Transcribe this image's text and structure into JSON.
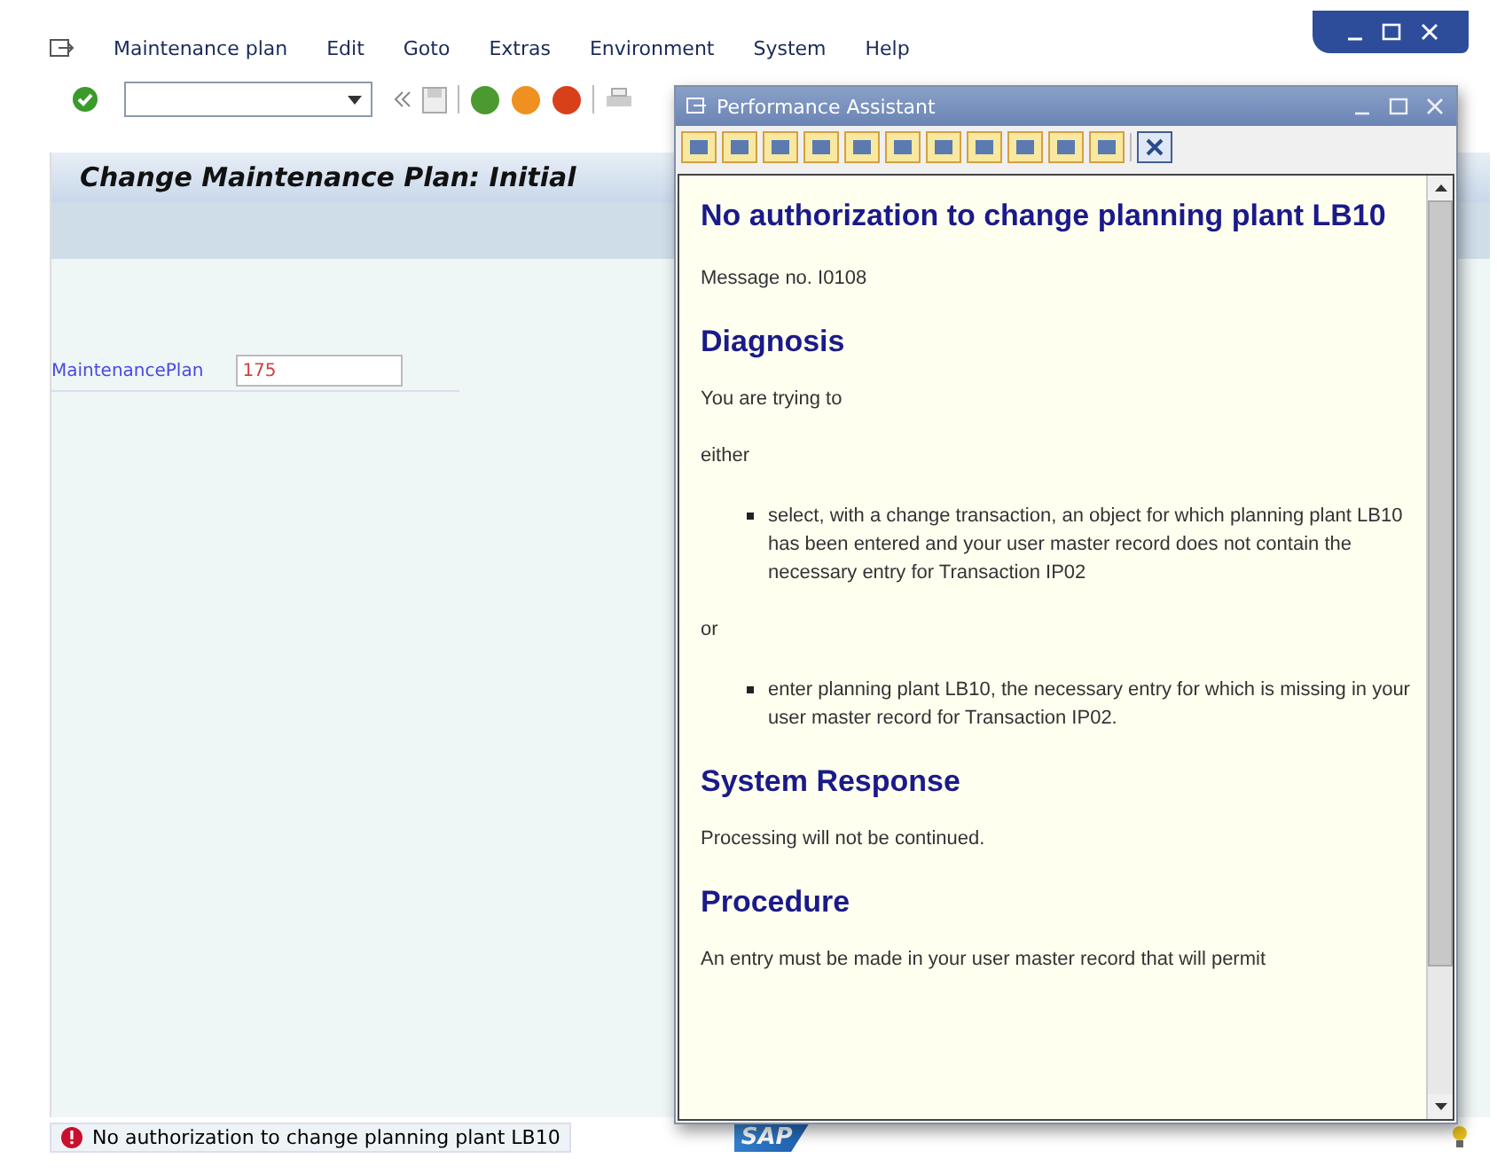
{
  "menu_bar": {
    "items": [
      "Maintenance plan",
      "Edit",
      "Goto",
      "Extras",
      "Environment",
      "System",
      "Help"
    ]
  },
  "screen_title": "Change Maintenance Plan: Initial",
  "field": {
    "label": "MaintenancePlan",
    "value": "175"
  },
  "status_bar": {
    "message": "No authorization to change planning plant LB10",
    "logo": "SAP"
  },
  "popup": {
    "title": "Performance Assistant",
    "content": [
      {
        "kind": "title",
        "text": "No authorization to change planning plant LB10"
      },
      {
        "kind": "text",
        "text": "Message no. I0108"
      },
      {
        "kind": "heading",
        "text": "Diagnosis"
      },
      {
        "kind": "text",
        "text": "You are trying to"
      },
      {
        "kind": "text",
        "text": "either"
      },
      {
        "kind": "bullet",
        "text": "select, with a change transaction, an object for which planning plant LB10 has been entered and your user master record does not contain the necessary entry for Transaction IP02"
      },
      {
        "kind": "text",
        "text": "or"
      },
      {
        "kind": "bullet",
        "text": "enter planning plant LB10, the necessary entry for which is missing in your user master record for Transaction IP02."
      },
      {
        "kind": "heading",
        "text": "System Response"
      },
      {
        "kind": "text",
        "text": "Processing will not be continued."
      },
      {
        "kind": "heading",
        "text": "Procedure"
      },
      {
        "kind": "text",
        "text": "An entry must be made in your user master record that will permit"
      }
    ]
  }
}
